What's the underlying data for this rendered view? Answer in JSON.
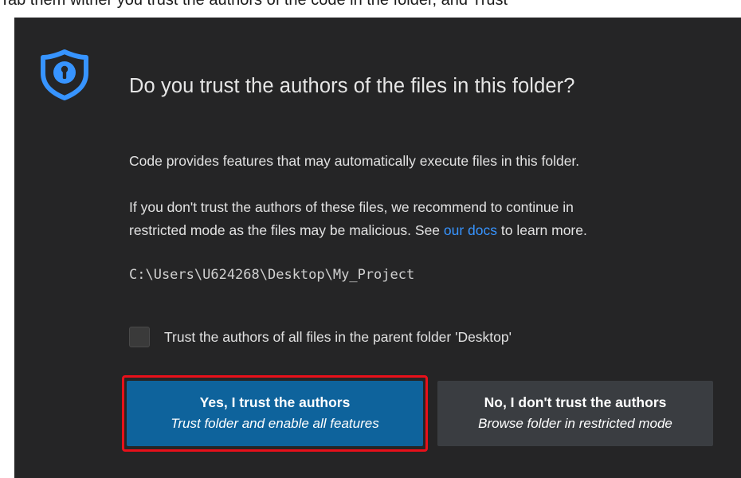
{
  "background_context": {
    "partial_text": "Tab them wither you trust the authors of the code in the folder, and Trust"
  },
  "dialog": {
    "icon": "shield-lock-icon",
    "title": "Do you trust the authors of the files in this folder?",
    "message_1": "Code provides features that may automatically execute files in this folder.",
    "message_2_line_1": "If you don't trust the authors of these files, we recommend to continue in",
    "message_2_line_2_before": "restricted mode as the files may be malicious. See ",
    "message_2_link": "our docs",
    "message_2_line_2_after": " to learn more.",
    "folder_path": "C:\\Users\\U624268\\Desktop\\My_Project",
    "checkbox_label": "Trust the authors of all files in the parent folder 'Desktop'",
    "checkbox_checked": false,
    "buttons": {
      "trust": {
        "label": "Yes, I trust the authors",
        "sublabel": "Trust folder and enable all features",
        "highlighted": true
      },
      "dont_trust": {
        "label": "No, I don't trust the authors",
        "sublabel": "Browse folder in restricted mode"
      }
    }
  },
  "colors": {
    "dialog_background": "#252526",
    "primary_button": "#0e639c",
    "secondary_button": "#3a3d41",
    "link": "#3794ff",
    "icon": "#3794ff",
    "highlight_outline": "#e8101a"
  }
}
